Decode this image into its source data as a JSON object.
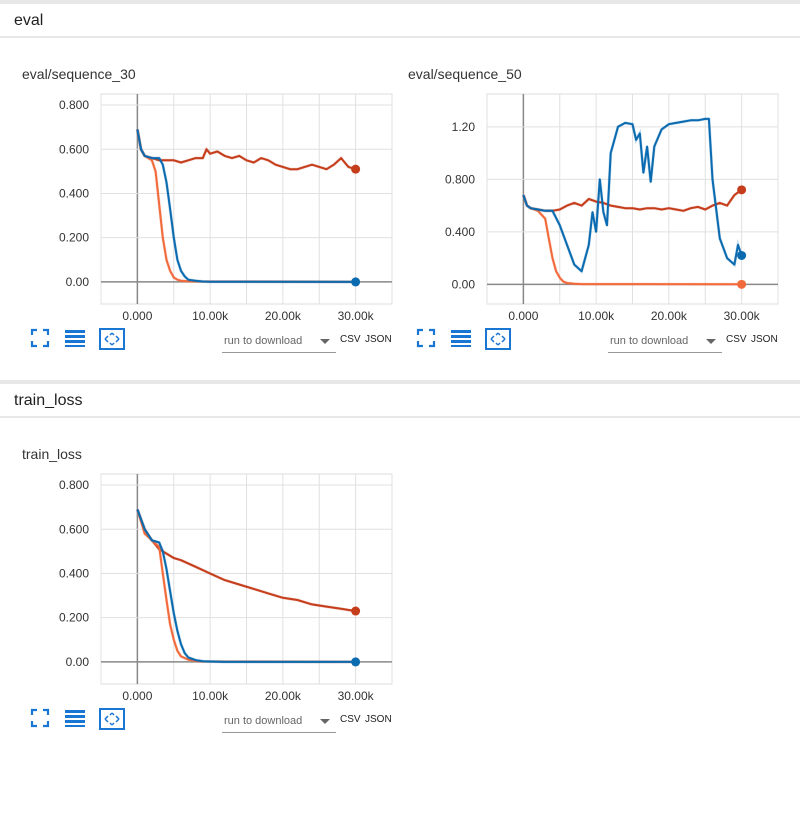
{
  "sections": [
    {
      "title": "eval"
    },
    {
      "title": "train_loss"
    }
  ],
  "controls": {
    "download_placeholder": "run to download",
    "csv_label": "CSV",
    "json_label": "JSON"
  },
  "colors": {
    "red": "#c53d1b",
    "orange": "#f26a3b",
    "blue": "#0b6bb0",
    "light_blue": "#a8cce8",
    "light_red": "#f3b3a1",
    "icon": "#1976d2"
  },
  "chart_data": [
    {
      "type": "line",
      "title": "eval/sequence_30",
      "xlim": [
        -5000,
        35000
      ],
      "ylim": [
        -0.1,
        0.85
      ],
      "xticks": [
        0,
        10000,
        20000,
        30000
      ],
      "xtick_labels": [
        "0.000",
        "10.00k",
        "20.00k",
        "30.00k"
      ],
      "yticks": [
        0,
        0.2,
        0.4,
        0.6,
        0.8
      ],
      "ytick_labels": [
        "0.00",
        "0.200",
        "0.400",
        "0.600",
        "0.800"
      ],
      "grid": true,
      "series": [
        {
          "color": "#c53d1b",
          "endpoint": true,
          "x": [
            0,
            500,
            1000,
            2000,
            3000,
            4000,
            5000,
            6000,
            7000,
            8000,
            9000,
            9500,
            10000,
            11000,
            12000,
            13000,
            14000,
            15000,
            16000,
            17000,
            18000,
            19000,
            20000,
            21000,
            22000,
            23000,
            24000,
            25000,
            26000,
            27000,
            28000,
            29000,
            30000
          ],
          "y": [
            0.69,
            0.6,
            0.57,
            0.56,
            0.55,
            0.55,
            0.55,
            0.54,
            0.55,
            0.56,
            0.56,
            0.6,
            0.58,
            0.59,
            0.57,
            0.56,
            0.57,
            0.55,
            0.54,
            0.56,
            0.55,
            0.53,
            0.52,
            0.51,
            0.51,
            0.52,
            0.53,
            0.52,
            0.51,
            0.53,
            0.56,
            0.52,
            0.51
          ]
        },
        {
          "color": "#f26a3b",
          "endpoint": false,
          "x": [
            0,
            500,
            1000,
            2000,
            2500,
            3000,
            3500,
            4000,
            4500,
            5000,
            5500,
            6000,
            7000,
            8000,
            30000
          ],
          "y": [
            0.69,
            0.6,
            0.57,
            0.55,
            0.5,
            0.35,
            0.2,
            0.1,
            0.05,
            0.02,
            0.01,
            0.005,
            0.003,
            0.002,
            0.0
          ]
        },
        {
          "color": "#0b6bb0",
          "endpoint": true,
          "x": [
            0,
            500,
            1000,
            2000,
            3000,
            3500,
            4000,
            4500,
            5000,
            5500,
            6000,
            6500,
            7000,
            8000,
            9000,
            10000,
            30000
          ],
          "y": [
            0.69,
            0.6,
            0.57,
            0.56,
            0.56,
            0.53,
            0.45,
            0.33,
            0.2,
            0.1,
            0.05,
            0.025,
            0.01,
            0.005,
            0.002,
            0.001,
            0.0
          ]
        }
      ]
    },
    {
      "type": "line",
      "title": "eval/sequence_50",
      "xlim": [
        -5000,
        35000
      ],
      "ylim": [
        -0.15,
        1.45
      ],
      "xticks": [
        0,
        10000,
        20000,
        30000
      ],
      "xtick_labels": [
        "0.000",
        "10.00k",
        "20.00k",
        "30.00k"
      ],
      "yticks": [
        0,
        0.4,
        0.8,
        1.2
      ],
      "ytick_labels": [
        "0.00",
        "0.400",
        "0.800",
        "1.20"
      ],
      "grid": true,
      "series": [
        {
          "color": "#c53d1b",
          "endpoint": true,
          "x": [
            0,
            500,
            1000,
            2000,
            3000,
            4000,
            5000,
            6000,
            7000,
            8000,
            9000,
            10000,
            11000,
            12000,
            13000,
            14000,
            15000,
            16000,
            17000,
            18000,
            19000,
            20000,
            21000,
            22000,
            23000,
            24000,
            25000,
            26000,
            27000,
            28000,
            29000,
            30000
          ],
          "y": [
            0.68,
            0.6,
            0.58,
            0.57,
            0.56,
            0.56,
            0.57,
            0.6,
            0.62,
            0.6,
            0.65,
            0.63,
            0.62,
            0.6,
            0.59,
            0.58,
            0.58,
            0.57,
            0.58,
            0.58,
            0.57,
            0.58,
            0.57,
            0.56,
            0.58,
            0.59,
            0.57,
            0.6,
            0.62,
            0.6,
            0.68,
            0.72
          ]
        },
        {
          "color": "#f26a3b",
          "endpoint": true,
          "x": [
            0,
            500,
            1000,
            2000,
            3000,
            3500,
            4000,
            4500,
            5000,
            5500,
            6000,
            7000,
            8000,
            30000
          ],
          "y": [
            0.68,
            0.6,
            0.58,
            0.56,
            0.5,
            0.35,
            0.2,
            0.1,
            0.05,
            0.02,
            0.01,
            0.005,
            0.002,
            0.0
          ]
        },
        {
          "color": "#0b6bb0",
          "endpoint": true,
          "x": [
            0,
            500,
            1000,
            2000,
            3000,
            4000,
            5000,
            6000,
            7000,
            8000,
            9000,
            9500,
            10000,
            10500,
            11000,
            11500,
            12000,
            13000,
            14000,
            15000,
            15500,
            16000,
            16500,
            17000,
            17500,
            18000,
            19000,
            20000,
            21000,
            22000,
            23000,
            24000,
            25000,
            25500,
            26000,
            27000,
            28000,
            29000,
            29500,
            30000
          ],
          "y": [
            0.68,
            0.6,
            0.58,
            0.57,
            0.56,
            0.56,
            0.45,
            0.3,
            0.15,
            0.1,
            0.3,
            0.55,
            0.4,
            0.8,
            0.55,
            0.45,
            1.0,
            1.2,
            1.23,
            1.22,
            1.1,
            1.15,
            0.85,
            1.05,
            0.78,
            1.05,
            1.18,
            1.22,
            1.23,
            1.24,
            1.25,
            1.25,
            1.26,
            1.26,
            0.8,
            0.35,
            0.2,
            0.15,
            0.3,
            0.22
          ]
        }
      ]
    },
    {
      "type": "line",
      "title": "train_loss",
      "xlim": [
        -5000,
        35000
      ],
      "ylim": [
        -0.1,
        0.85
      ],
      "xticks": [
        0,
        10000,
        20000,
        30000
      ],
      "xtick_labels": [
        "0.000",
        "10.00k",
        "20.00k",
        "30.00k"
      ],
      "yticks": [
        0,
        0.2,
        0.4,
        0.6,
        0.8
      ],
      "ytick_labels": [
        "0.00",
        "0.200",
        "0.400",
        "0.600",
        "0.800"
      ],
      "grid": true,
      "series": [
        {
          "color": "#c53d1b",
          "endpoint": true,
          "x": [
            0,
            1000,
            2000,
            3000,
            4000,
            5000,
            6000,
            8000,
            10000,
            12000,
            14000,
            16000,
            18000,
            20000,
            22000,
            24000,
            26000,
            28000,
            30000
          ],
          "y": [
            0.69,
            0.6,
            0.55,
            0.51,
            0.49,
            0.47,
            0.46,
            0.43,
            0.4,
            0.37,
            0.35,
            0.33,
            0.31,
            0.29,
            0.28,
            0.26,
            0.25,
            0.24,
            0.23
          ]
        },
        {
          "color": "#f26a3b",
          "endpoint": false,
          "x": [
            0,
            1000,
            2000,
            3000,
            3500,
            4000,
            4500,
            5000,
            5500,
            6000,
            7000,
            8000,
            9000,
            30000
          ],
          "y": [
            0.69,
            0.58,
            0.55,
            0.52,
            0.4,
            0.28,
            0.17,
            0.1,
            0.05,
            0.025,
            0.01,
            0.004,
            0.002,
            0.0
          ]
        },
        {
          "color": "#0b6bb0",
          "endpoint": true,
          "x": [
            0,
            1000,
            2000,
            3000,
            3500,
            4000,
            4500,
            5000,
            5500,
            6000,
            6500,
            7000,
            8000,
            9000,
            10000,
            12000,
            30000
          ],
          "y": [
            0.69,
            0.6,
            0.55,
            0.54,
            0.5,
            0.42,
            0.32,
            0.22,
            0.14,
            0.08,
            0.04,
            0.02,
            0.008,
            0.003,
            0.002,
            0.0,
            0.0
          ]
        }
      ]
    }
  ]
}
